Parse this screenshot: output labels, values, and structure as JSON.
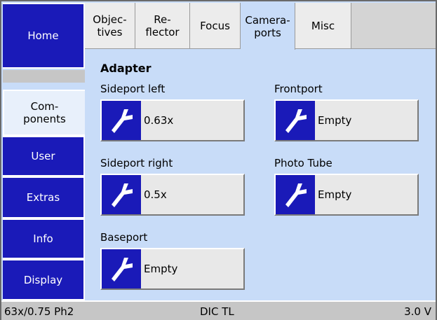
{
  "sidebar": {
    "items": [
      {
        "label": "Home"
      },
      {
        "label": "Com-\nponents"
      },
      {
        "label": "User"
      },
      {
        "label": "Extras"
      },
      {
        "label": "Info"
      },
      {
        "label": "Display"
      }
    ]
  },
  "tabs": [
    {
      "label": "Objec-\ntives"
    },
    {
      "label": "Re-\nflector"
    },
    {
      "label": "Focus"
    },
    {
      "label": "Camera-\nports"
    },
    {
      "label": "Misc"
    }
  ],
  "content": {
    "title": "Adapter",
    "slots": [
      {
        "label": "Sideport left",
        "value": "0.63x",
        "icon": "wrench-icon"
      },
      {
        "label": "Frontport",
        "value": "Empty",
        "icon": "wrench-icon"
      },
      {
        "label": "Sideport right",
        "value": "0.5x",
        "icon": "wrench-icon"
      },
      {
        "label": "Photo Tube",
        "value": "Empty",
        "icon": "wrench-icon"
      },
      {
        "label": "Baseport",
        "value": "Empty",
        "icon": "wrench-icon"
      }
    ]
  },
  "status": {
    "objective": "63x/0.75 Ph2",
    "mode": "DIC TL",
    "voltage": "3.0 V"
  },
  "colors": {
    "button_blue": "#1a1ab8",
    "panel_light_blue": "#c8dcf8",
    "bar_gray": "#c6c6c6"
  }
}
